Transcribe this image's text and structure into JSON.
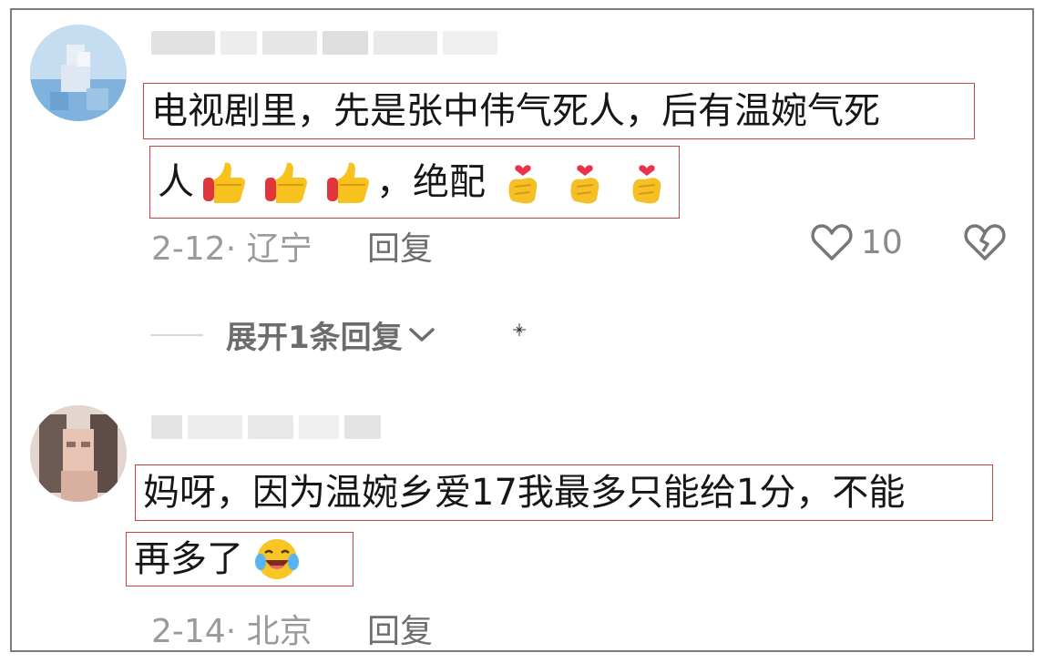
{
  "comments": [
    {
      "line1": "电视剧里，先是张中伟气死人，后有温婉气死",
      "line2_prefix": "人",
      "line2_mid": "，绝配",
      "emoji_a": [
        "thumbs-up",
        "thumbs-up",
        "thumbs-up"
      ],
      "emoji_b": [
        "finger-heart",
        "finger-heart",
        "finger-heart"
      ],
      "meta": "2-12· 辽宁",
      "reply_label": "回复",
      "like_count": "10"
    },
    {
      "line1": "妈呀，因为温婉乡爱17我最多只能给1分，不能",
      "line2": "再多了",
      "emoji_c": "laughing-crying",
      "meta": "2-14· 北京",
      "reply_label": "回复"
    }
  ],
  "expand_replies": "展开1条回复",
  "colors": {
    "highlight_border": "#c84343",
    "meta_text": "#9a9a9a",
    "body_text": "#161616"
  }
}
